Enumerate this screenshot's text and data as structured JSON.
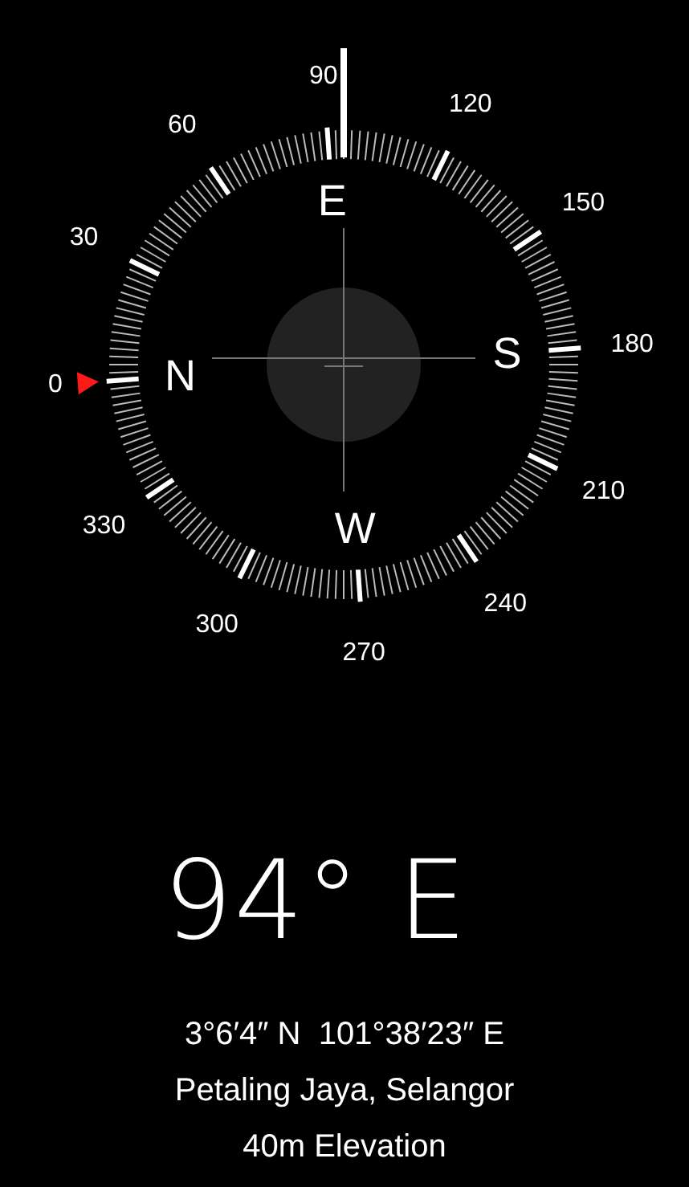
{
  "compass": {
    "degree_labels": [
      "0",
      "30",
      "60",
      "90",
      "120",
      "150",
      "180",
      "210",
      "240",
      "270",
      "300",
      "330"
    ],
    "cardinals": [
      "N",
      "E",
      "S",
      "W"
    ]
  },
  "heading": "94° E",
  "coordinates": "3°6′4″ N  101°38′23″ E",
  "location": "Petaling Jaya, Selangor",
  "elevation": "40m Elevation"
}
